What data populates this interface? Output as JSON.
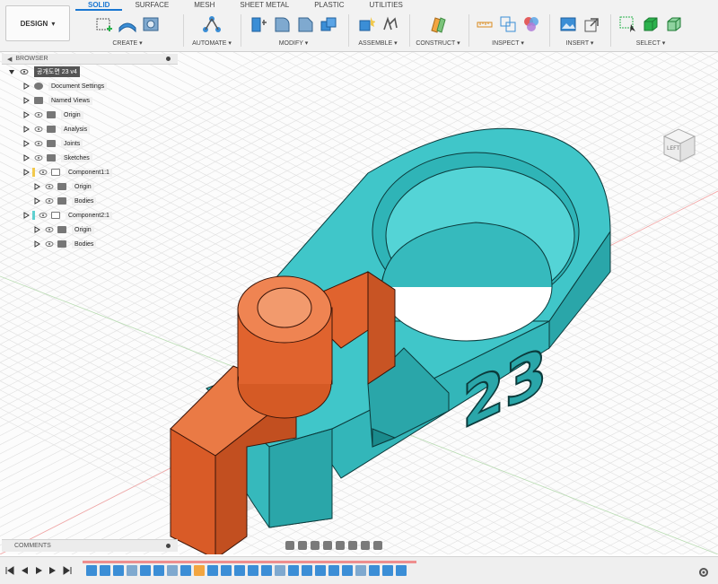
{
  "workspace": {
    "label": "DESIGN",
    "chevron": "▾"
  },
  "tabs": [
    "SOLID",
    "SURFACE",
    "MESH",
    "SHEET METAL",
    "PLASTIC",
    "UTILITIES"
  ],
  "active_tab": "SOLID",
  "groups": {
    "create": "CREATE ▾",
    "automate": "AUTOMATE ▾",
    "modify": "MODIFY ▾",
    "assemble": "ASSEMBLE ▾",
    "construct": "CONSTRUCT ▾",
    "inspect": "INSPECT ▾",
    "insert": "INSERT ▾",
    "select": "SELECT ▾"
  },
  "browser": {
    "title": "BROWSER",
    "root": "공개도면 23 v4",
    "items": [
      {
        "label": "Document Settings",
        "icon": "gear-icon"
      },
      {
        "label": "Named Views",
        "icon": "folder-icon"
      },
      {
        "label": "Origin",
        "icon": "folder-icon"
      },
      {
        "label": "Analysis",
        "icon": "folder-icon"
      },
      {
        "label": "Joints",
        "icon": "folder-icon"
      },
      {
        "label": "Sketches",
        "icon": "folder-icon"
      },
      {
        "label": "Component1:1",
        "icon": "component-icon",
        "color": "#f2c94c"
      },
      {
        "label": "Origin",
        "icon": "folder-icon"
      },
      {
        "label": "Bodies",
        "icon": "folder-icon"
      },
      {
        "label": "Component2:1",
        "icon": "component-icon",
        "color": "#5fd0d0"
      },
      {
        "label": "Origin",
        "icon": "folder-icon"
      },
      {
        "label": "Bodies",
        "icon": "folder-icon"
      }
    ]
  },
  "comments": {
    "title": "COMMENTS"
  },
  "model": {
    "engraving": "23",
    "teal": "#3cc3c6",
    "orange": "#e0632e"
  },
  "viewcube": {
    "label": "LEFT"
  },
  "colors": {
    "accent": "#1a77d2",
    "timeline_bar": "#ee8e8e"
  }
}
